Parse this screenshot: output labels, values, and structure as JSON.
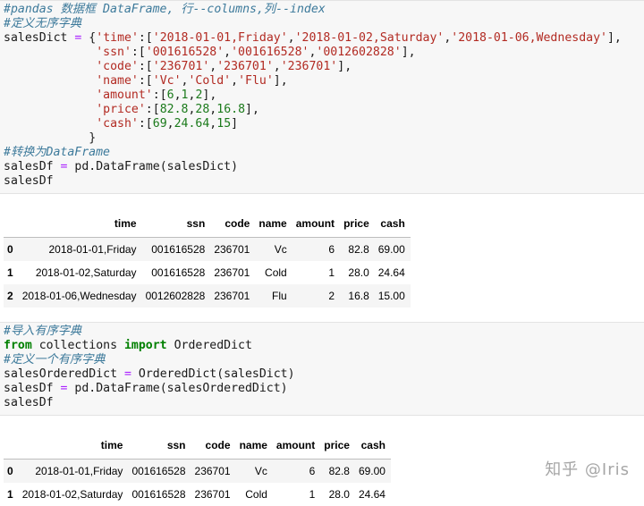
{
  "cell1": {
    "lines": [
      [
        {
          "t": "#pandas 数据框 DataFrame, 行--columns,列--index",
          "c": "cm"
        }
      ],
      [
        {
          "t": "#定义无序字典",
          "c": "cm"
        }
      ],
      [
        {
          "t": "salesDict "
        },
        {
          "t": "=",
          "c": "op"
        },
        {
          "t": " {"
        },
        {
          "t": "'time'",
          "c": "st"
        },
        {
          "t": ":["
        },
        {
          "t": "'2018-01-01,Friday'",
          "c": "st"
        },
        {
          "t": ","
        },
        {
          "t": "'2018-01-02,Saturday'",
          "c": "st"
        },
        {
          "t": ","
        },
        {
          "t": "'2018-01-06,Wednesday'",
          "c": "st"
        },
        {
          "t": "],"
        }
      ],
      [
        {
          "t": "             "
        },
        {
          "t": "'ssn'",
          "c": "st"
        },
        {
          "t": ":["
        },
        {
          "t": "'001616528'",
          "c": "st"
        },
        {
          "t": ","
        },
        {
          "t": "'001616528'",
          "c": "st"
        },
        {
          "t": ","
        },
        {
          "t": "'0012602828'",
          "c": "st"
        },
        {
          "t": "],"
        }
      ],
      [
        {
          "t": "             "
        },
        {
          "t": "'code'",
          "c": "st"
        },
        {
          "t": ":["
        },
        {
          "t": "'236701'",
          "c": "st"
        },
        {
          "t": ","
        },
        {
          "t": "'236701'",
          "c": "st"
        },
        {
          "t": ","
        },
        {
          "t": "'236701'",
          "c": "st"
        },
        {
          "t": "],"
        }
      ],
      [
        {
          "t": "             "
        },
        {
          "t": "'name'",
          "c": "st"
        },
        {
          "t": ":["
        },
        {
          "t": "'Vc'",
          "c": "st"
        },
        {
          "t": ","
        },
        {
          "t": "'Cold'",
          "c": "st"
        },
        {
          "t": ","
        },
        {
          "t": "'Flu'",
          "c": "st"
        },
        {
          "t": "],"
        }
      ],
      [
        {
          "t": "             "
        },
        {
          "t": "'amount'",
          "c": "st"
        },
        {
          "t": ":["
        },
        {
          "t": "6",
          "c": "nm"
        },
        {
          "t": ","
        },
        {
          "t": "1",
          "c": "nm"
        },
        {
          "t": ","
        },
        {
          "t": "2",
          "c": "nm"
        },
        {
          "t": "],"
        }
      ],
      [
        {
          "t": "             "
        },
        {
          "t": "'price'",
          "c": "st"
        },
        {
          "t": ":["
        },
        {
          "t": "82.8",
          "c": "nm"
        },
        {
          "t": ","
        },
        {
          "t": "28",
          "c": "nm"
        },
        {
          "t": ","
        },
        {
          "t": "16.8",
          "c": "nm"
        },
        {
          "t": "],"
        }
      ],
      [
        {
          "t": "             "
        },
        {
          "t": "'cash'",
          "c": "st"
        },
        {
          "t": ":["
        },
        {
          "t": "69",
          "c": "nm"
        },
        {
          "t": ","
        },
        {
          "t": "24.64",
          "c": "nm"
        },
        {
          "t": ","
        },
        {
          "t": "15",
          "c": "nm"
        },
        {
          "t": "]"
        }
      ],
      [
        {
          "t": "            }"
        }
      ],
      [
        {
          "t": "#转换为DataFrame",
          "c": "cm"
        }
      ],
      [
        {
          "t": "salesDf "
        },
        {
          "t": "=",
          "c": "op"
        },
        {
          "t": " pd.DataFrame(salesDict)"
        }
      ],
      [
        {
          "t": "salesDf"
        }
      ]
    ]
  },
  "cell2": {
    "lines": [
      [
        {
          "t": "#导入有序字典",
          "c": "cm"
        }
      ],
      [
        {
          "t": "from",
          "c": "kw"
        },
        {
          "t": " collections "
        },
        {
          "t": "import",
          "c": "kw"
        },
        {
          "t": " OrderedDict"
        }
      ],
      [
        {
          "t": "#定义一个有序字典",
          "c": "cm"
        }
      ],
      [
        {
          "t": "salesOrderedDict "
        },
        {
          "t": "=",
          "c": "op"
        },
        {
          "t": " OrderedDict(salesDict)"
        }
      ],
      [
        {
          "t": "salesDf "
        },
        {
          "t": "=",
          "c": "op"
        },
        {
          "t": " pd.DataFrame(salesOrderedDict)"
        }
      ],
      [
        {
          "t": "salesDf"
        }
      ]
    ]
  },
  "table1": {
    "columns": [
      "time",
      "ssn",
      "code",
      "name",
      "amount",
      "price",
      "cash"
    ],
    "rows": [
      [
        "0",
        "2018-01-01,Friday",
        "001616528",
        "236701",
        "Vc",
        "6",
        "82.8",
        "69.00"
      ],
      [
        "1",
        "2018-01-02,Saturday",
        "001616528",
        "236701",
        "Cold",
        "1",
        "28.0",
        "24.64"
      ],
      [
        "2",
        "2018-01-06,Wednesday",
        "0012602828",
        "236701",
        "Flu",
        "2",
        "16.8",
        "15.00"
      ]
    ]
  },
  "table2": {
    "columns": [
      "time",
      "ssn",
      "code",
      "name",
      "amount",
      "price",
      "cash"
    ],
    "rows": [
      [
        "0",
        "2018-01-01,Friday",
        "001616528",
        "236701",
        "Vc",
        "6",
        "82.8",
        "69.00"
      ],
      [
        "1",
        "2018-01-02,Saturday",
        "001616528",
        "236701",
        "Cold",
        "1",
        "28.0",
        "24.64"
      ]
    ]
  },
  "watermark": "知乎 @Iris"
}
